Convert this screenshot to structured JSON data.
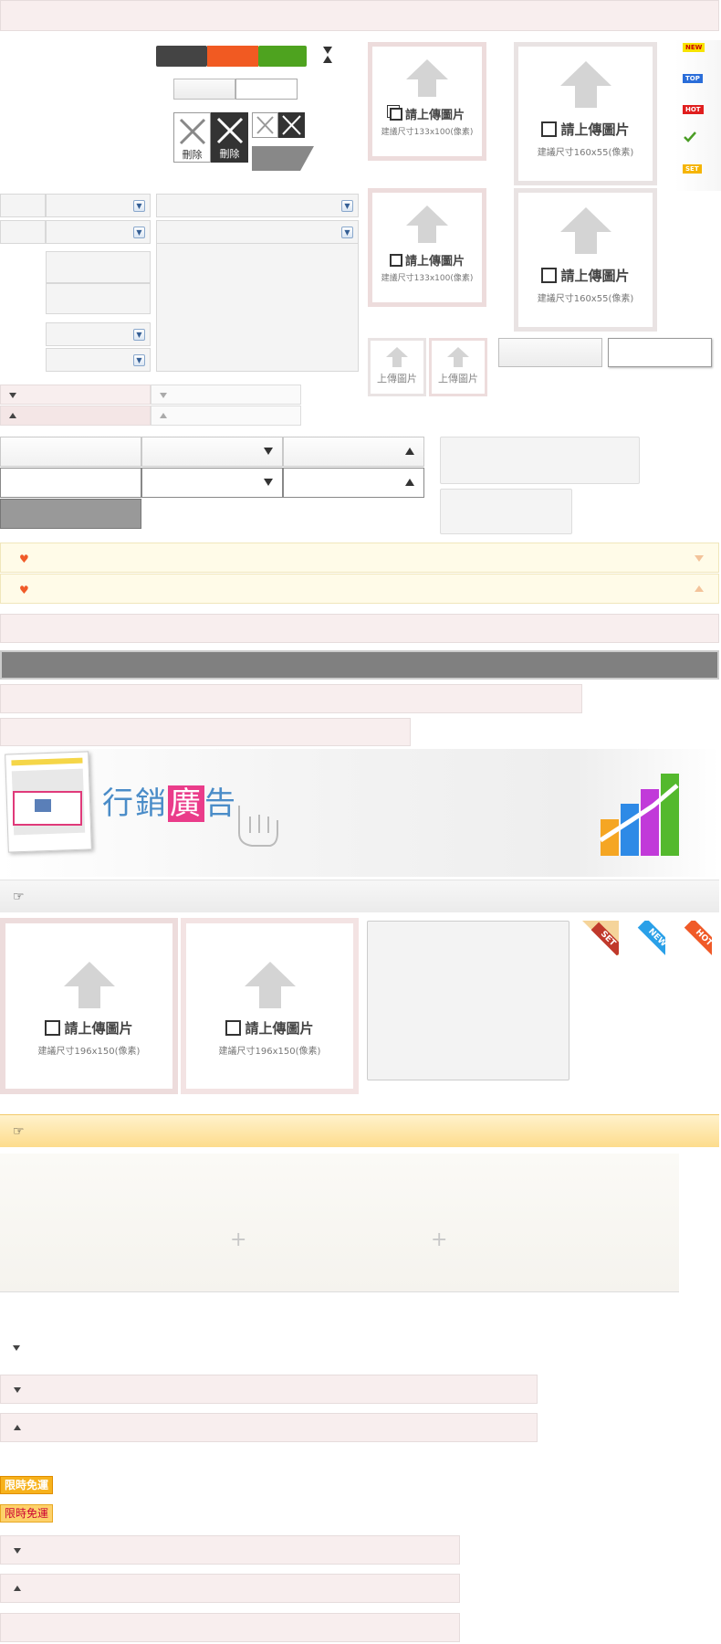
{
  "colors": {
    "dark": "#444444",
    "orange": "#f15a22",
    "green": "#4ea31f",
    "pink_bg": "#f8eeee",
    "yellow_bg": "#fffbe8",
    "gray_bar": "#808080",
    "heart": "#f05a28"
  },
  "delete_buttons": {
    "delete_label_1": "刪除",
    "delete_label_2": "刪除"
  },
  "upload": {
    "title": "請上傳圖片",
    "hint_133": "建議尺寸133x100(像素)",
    "hint_160": "建議尺寸160x55(像素)",
    "hint_196": "建議尺寸196x150(像素)",
    "small_label": "上傳圖片"
  },
  "badges": {
    "new": "NEW",
    "top": "TOP",
    "hot": "HOT",
    "set": "SET"
  },
  "ribbons": {
    "set": "SET",
    "new": "NEW",
    "hot": "HOT"
  },
  "banner": {
    "title_part1": "行銷",
    "title_part2": "廣",
    "title_part3": "告"
  },
  "promo": {
    "label_1": "限時免運",
    "label_2": "限時免運"
  },
  "icons": {
    "heart": "heart-icon",
    "hand": "pointing-hand-icon",
    "check": "check-icon",
    "plus": "plus-icon",
    "hourglass": "hourglass-icon"
  }
}
